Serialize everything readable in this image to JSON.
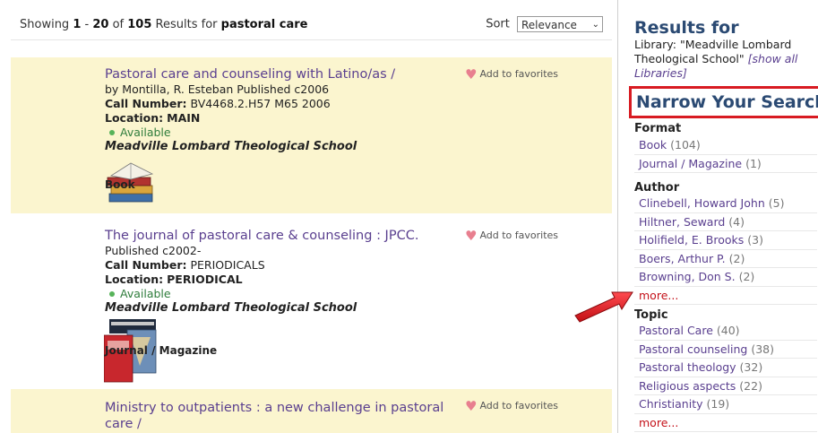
{
  "results": {
    "showing_prefix": "Showing",
    "range_start": "1",
    "range_sep": "-",
    "range_end": "20",
    "of": "of",
    "total": "105",
    "results_for": "Results for",
    "query": "pastoral care"
  },
  "sort": {
    "label": "Sort",
    "selected": "Relevance"
  },
  "records": [
    {
      "title": "Pastoral care and counseling with Latino/as /",
      "byline": "by Montilla, R. Esteban Published c2006",
      "call_label": "Call Number:",
      "call_value": "BV4468.2.H57 M65 2006",
      "loc_label": "Location:",
      "loc_value": "MAIN",
      "availability": "Available",
      "library": "Meadville Lombard Theological School",
      "format": "Book",
      "favorite": "Add to favorites"
    },
    {
      "title": "The journal of pastoral care & counseling : JPCC.",
      "byline": "Published c2002-",
      "call_label": "Call Number:",
      "call_value": "PERIODICALS",
      "loc_label": "Location:",
      "loc_value": "PERIODICAL",
      "availability": "Available",
      "library": "Meadville Lombard Theological School",
      "format": "Journal / Magazine",
      "favorite": "Add to favorites"
    },
    {
      "title": "Ministry to outpatients : a new challenge in pastoral care /",
      "favorite": "Add to favorites"
    }
  ],
  "sidebar": {
    "results_for": "Results for",
    "library_text": "Library: \"Meadville Lombard Theological School\"",
    "show_all": "[show all Libraries]",
    "narrow_title": "Narrow Your Search",
    "format": {
      "heading": "Format",
      "items": [
        {
          "label": "Book",
          "count": "(104)"
        },
        {
          "label": "Journal / Magazine",
          "count": "(1)"
        }
      ]
    },
    "author": {
      "heading": "Author",
      "items": [
        {
          "label": "Clinebell, Howard John",
          "count": "(5)"
        },
        {
          "label": "Hiltner, Seward",
          "count": "(4)"
        },
        {
          "label": "Holifield, E. Brooks",
          "count": "(3)"
        },
        {
          "label": "Boers, Arthur P.",
          "count": "(2)"
        },
        {
          "label": "Browning, Don S.",
          "count": "(2)"
        }
      ],
      "more": "more..."
    },
    "topic": {
      "heading": "Topic",
      "items": [
        {
          "label": "Pastoral Care",
          "count": "(40)"
        },
        {
          "label": "Pastoral counseling",
          "count": "(38)"
        },
        {
          "label": "Pastoral theology",
          "count": "(32)"
        },
        {
          "label": "Religious aspects",
          "count": "(22)"
        },
        {
          "label": "Christianity",
          "count": "(19)"
        }
      ],
      "more": "more..."
    }
  },
  "colors": {
    "highlight_border": "#d81b22",
    "arrow": "#e0141b",
    "link": "#5a3f8f",
    "heading": "#2b4a73",
    "record_bg": "#fbf5cf"
  }
}
